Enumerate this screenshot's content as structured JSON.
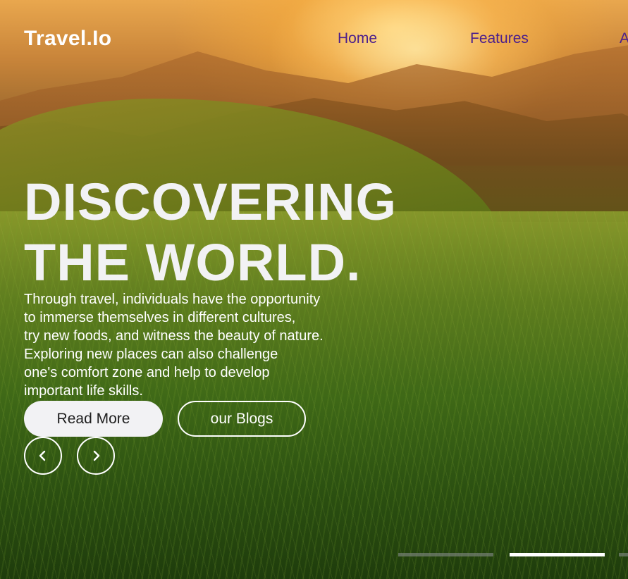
{
  "brand": {
    "name": "Travel.Io"
  },
  "nav": {
    "items": [
      "Home",
      "Features",
      "About"
    ],
    "color": "#4b1e8c"
  },
  "hero": {
    "headline_line1": "DISCOVERING",
    "headline_line2": "THE WORLD.",
    "description_lines": [
      "Through travel, individuals have the opportunity",
      "to immerse themselves in different cultures,",
      "try new foods, and witness the beauty of nature.",
      "Exploring new places can also challenge",
      "one's comfort zone and help to develop",
      "important life skills."
    ],
    "primary_button": "Read More",
    "secondary_button": "our Blogs"
  },
  "carousel": {
    "prev_icon": "chevron-left-icon",
    "next_icon": "chevron-right-icon",
    "indicator_count": 3,
    "active_indicator": 2
  },
  "colors": {
    "headline": "#f2f2f4",
    "button_bg": "#f2f2f4",
    "indicator_active": "#ffffff"
  }
}
